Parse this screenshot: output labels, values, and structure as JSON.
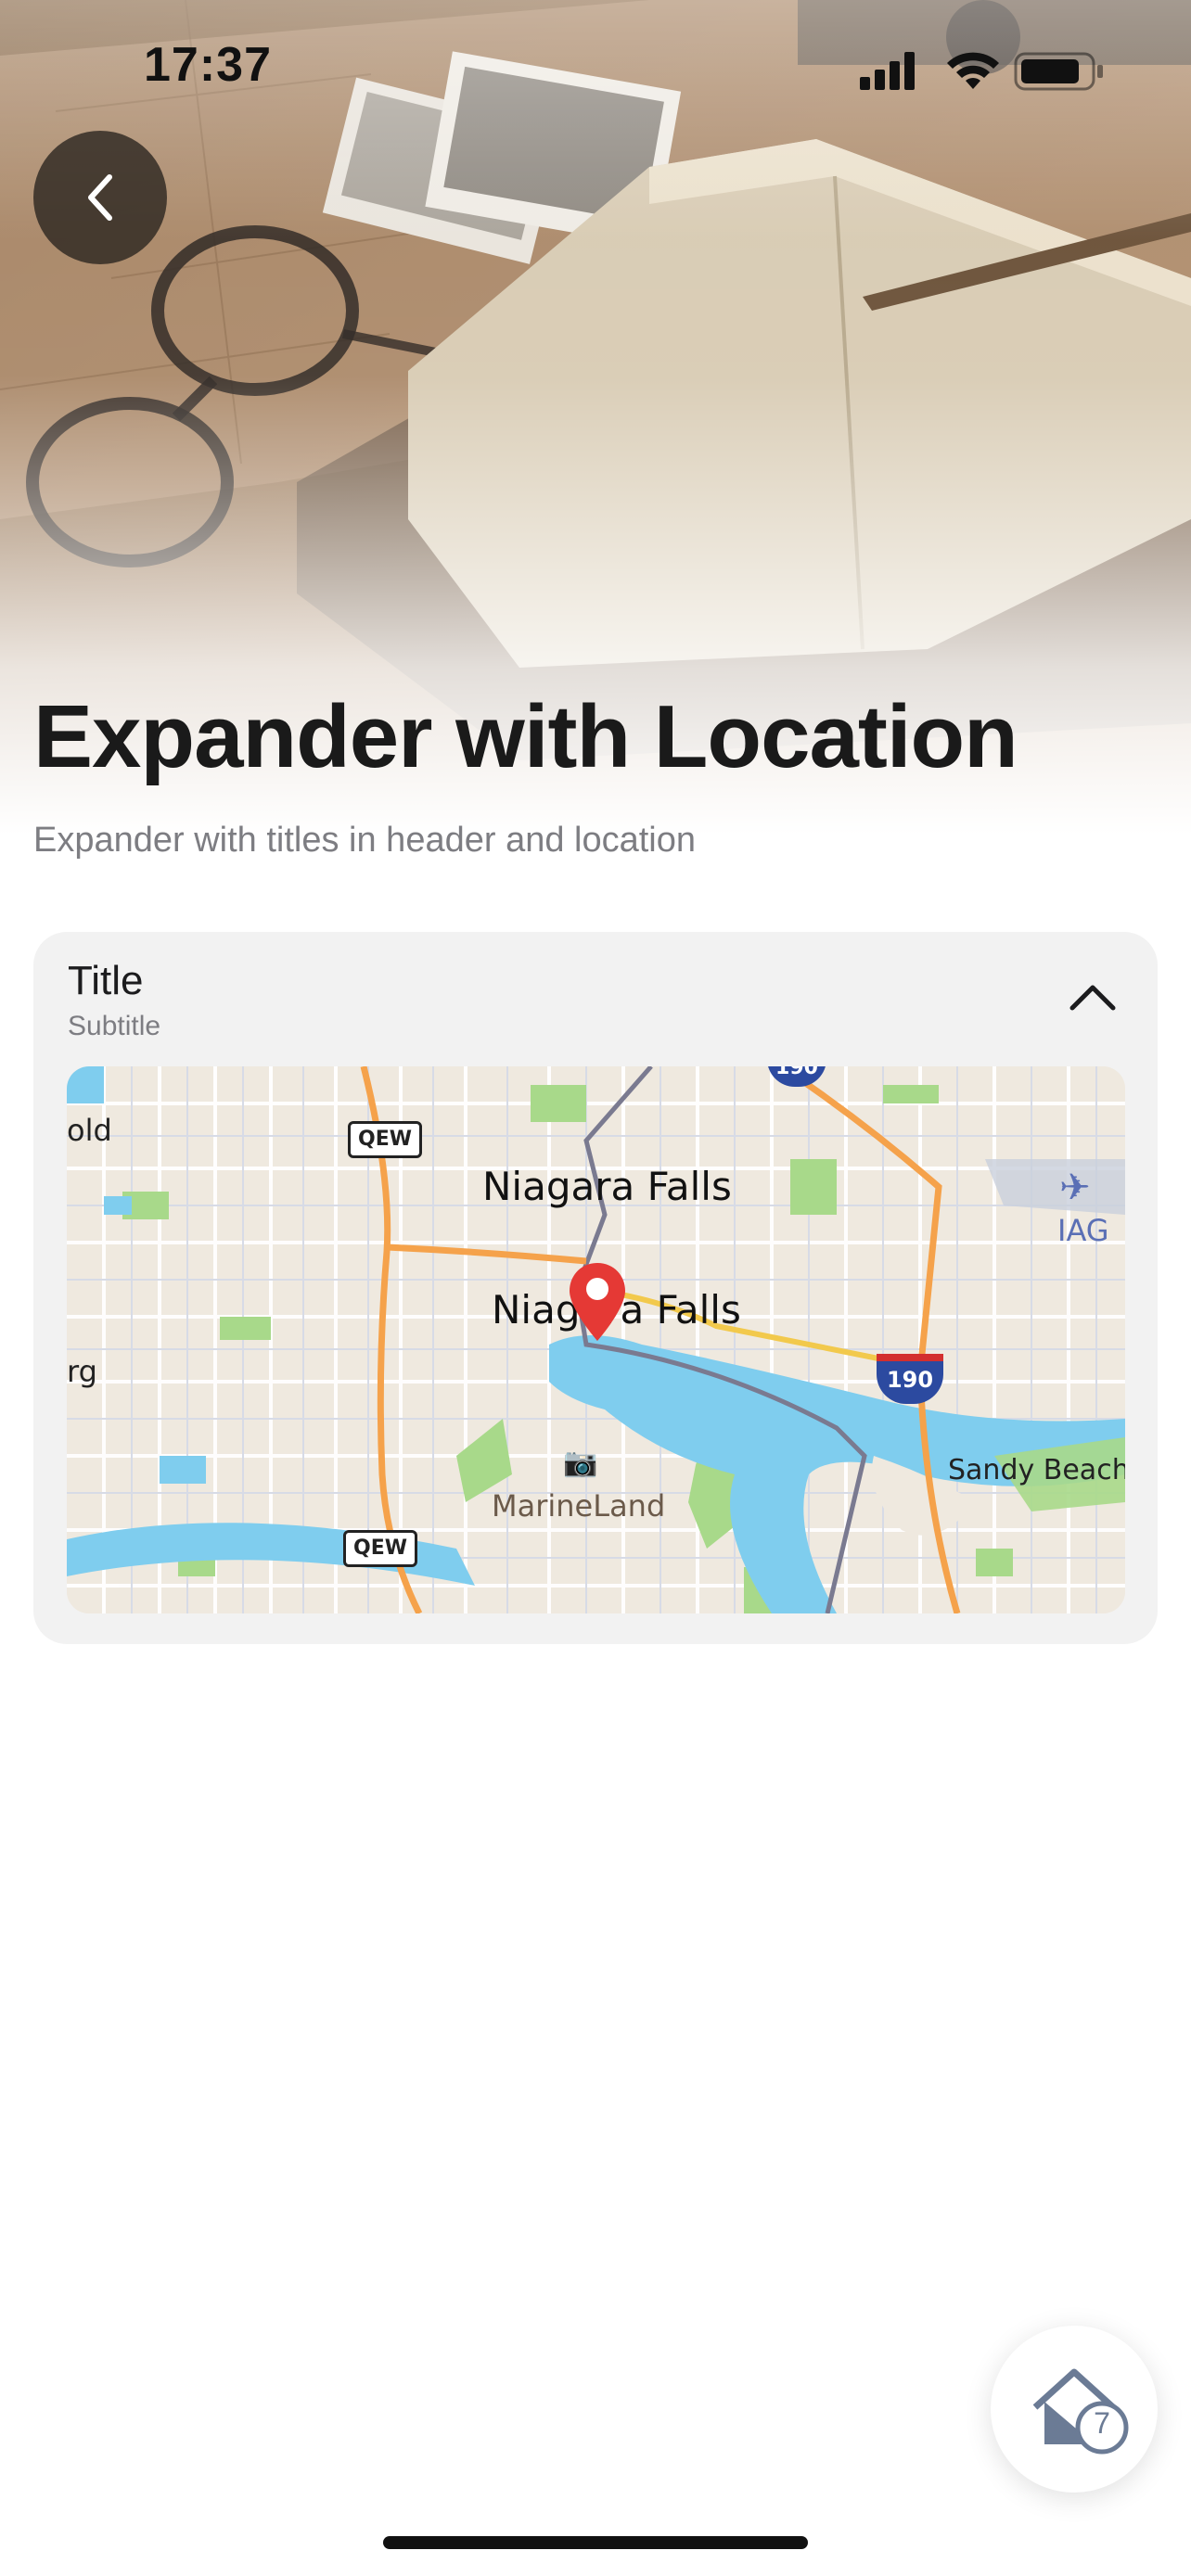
{
  "status_bar": {
    "time": "17:37",
    "icons": [
      "signal-icon",
      "wifi-icon",
      "battery-icon"
    ]
  },
  "header": {
    "back_icon": "chevron-left-icon",
    "title": "Expander with Location",
    "subtitle": "Expander with titles in header and location"
  },
  "expander": {
    "title": "Title",
    "subtitle": "Subtitle",
    "toggle_icon": "chevron-up-icon",
    "expanded": true,
    "map": {
      "labels": {
        "city_upper": "Niagara Falls",
        "city_lower": "Niagara Falls",
        "left_top": "old",
        "left_mid": "rg",
        "airport": "IAG",
        "marine": "MarineLand",
        "beach": "Sandy Beach",
        "highway_qew_1": "QEW",
        "highway_qew_2": "QEW",
        "interstate": "190",
        "interstate_top": "190"
      },
      "pin_icon": "map-pin-icon",
      "accent_colors": {
        "water": "#7fcdee",
        "land": "#efe9df",
        "highway": "#f5a24b",
        "park": "#a8d98a",
        "pin": "#e53935"
      }
    }
  },
  "floating_button": {
    "icon": "home-icon",
    "badge": "7"
  }
}
